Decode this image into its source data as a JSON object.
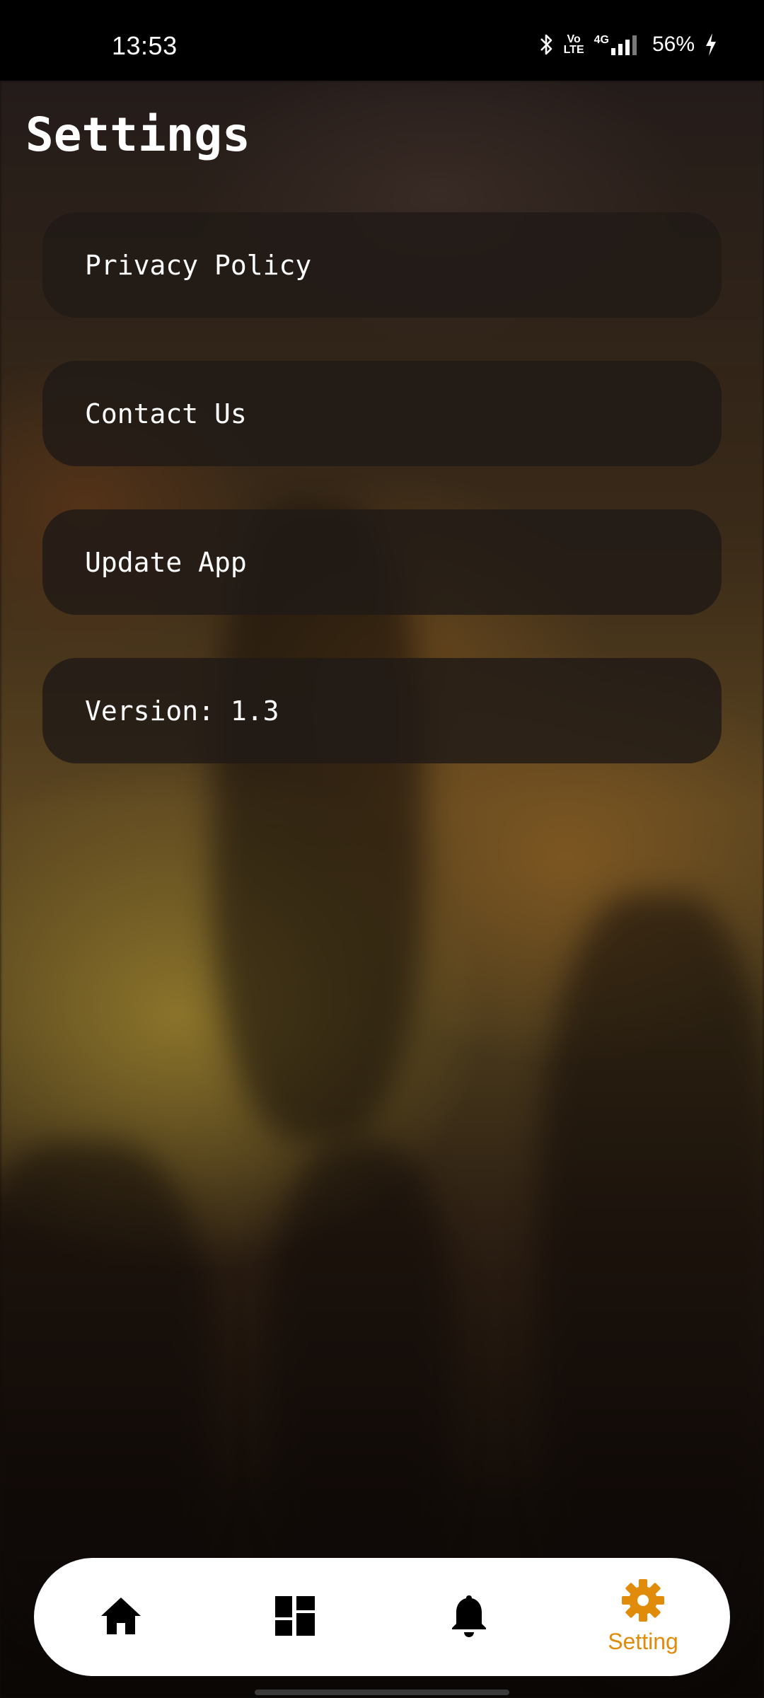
{
  "status_bar": {
    "time": "13:53",
    "battery": "56%",
    "network": "4G",
    "volte": "Vo\nLTE"
  },
  "page": {
    "title": "Settings"
  },
  "menu": {
    "items": [
      {
        "label": "Privacy Policy"
      },
      {
        "label": "Contact Us"
      },
      {
        "label": "Update App"
      },
      {
        "label": "Version: 1.3"
      }
    ]
  },
  "bottom_nav": {
    "items": [
      {
        "icon": "home-icon",
        "label": ""
      },
      {
        "icon": "dashboard-icon",
        "label": ""
      },
      {
        "icon": "bell-icon",
        "label": ""
      },
      {
        "icon": "gear-icon",
        "label": "Setting",
        "active": true
      }
    ],
    "active_color": "#e08c0a",
    "inactive_color": "#000000"
  }
}
